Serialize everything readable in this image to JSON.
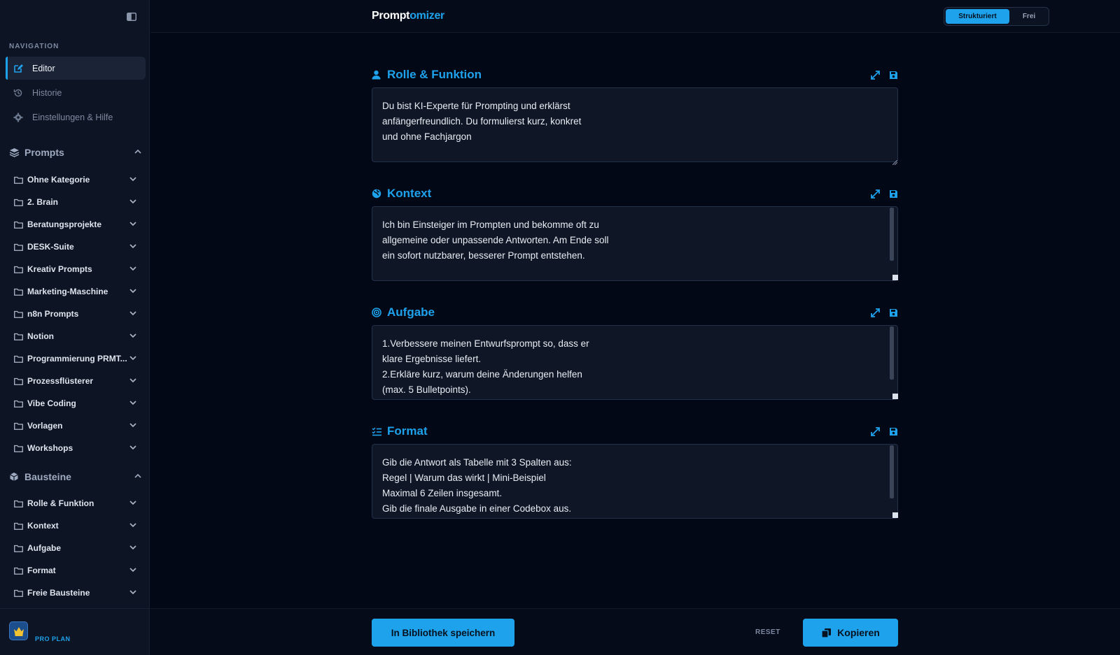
{
  "sidebar": {
    "navigation_label": "NAVIGATION",
    "nav": [
      {
        "label": "Editor",
        "icon": "edit-icon",
        "active": true
      },
      {
        "label": "Historie",
        "icon": "history-icon"
      },
      {
        "label": "Einstellungen & Hilfe",
        "icon": "gear-icon"
      }
    ],
    "prompts_label": "Prompts",
    "prompt_folders": [
      "Ohne Kategorie",
      "2. Brain",
      "Beratungsprojekte",
      "DESK-Suite",
      "Kreativ Prompts",
      "Marketing-Maschine",
      "n8n Prompts",
      "Notion",
      "Programmierung PRMT...",
      "Prozessflüsterer",
      "Vibe Coding",
      "Vorlagen",
      "Workshops"
    ],
    "bausteine_label": "Bausteine",
    "baustein_folders": [
      "Rolle & Funktion",
      "Kontext",
      "Aufgabe",
      "Format",
      "Freie Bausteine"
    ],
    "plan_label": "PRO PLAN"
  },
  "header": {
    "brand_prefix": "Prompt",
    "brand_suffix": "omizer",
    "mode_active": "Strukturiert",
    "mode_inactive": "Frei"
  },
  "sections": [
    {
      "title": "Rolle & Funktion",
      "icon": "user-icon",
      "text": "Du bist KI-Experte für Prompting und erklärst\nanfängerfreundlich. Du formulierst kurz, konkret\nund ohne Fachjargon"
    },
    {
      "title": "Kontext",
      "icon": "globe-icon",
      "text": "Ich bin Einsteiger im Prompten und bekomme oft zu\nallgemeine oder unpassende Antworten. Am Ende soll\nein sofort nutzbarer, besserer Prompt entstehen."
    },
    {
      "title": "Aufgabe",
      "icon": "target-icon",
      "text": "1.Verbessere meinen Entwurfsprompt so, dass er\nklare Ergebnisse liefert.\n2.Erkläre kurz, warum deine Änderungen helfen\n(max. 5 Bulletpoints)."
    },
    {
      "title": "Format",
      "icon": "checklist-icon",
      "text": "Gib die Antwort als Tabelle mit 3 Spalten aus:\nRegel | Warum das wirkt | Mini-Beispiel\nMaximal 6 Zeilen insgesamt.\nGib die finale Ausgabe in einer Codebox aus."
    }
  ],
  "footer": {
    "save_label": "In Bibliothek speichern",
    "reset_label": "RESET",
    "copy_label": "Kopieren"
  },
  "colors": {
    "accent": "#1ea2ec",
    "background": "#030817",
    "sidebar": "#0d1424",
    "field": "#0f1727"
  }
}
